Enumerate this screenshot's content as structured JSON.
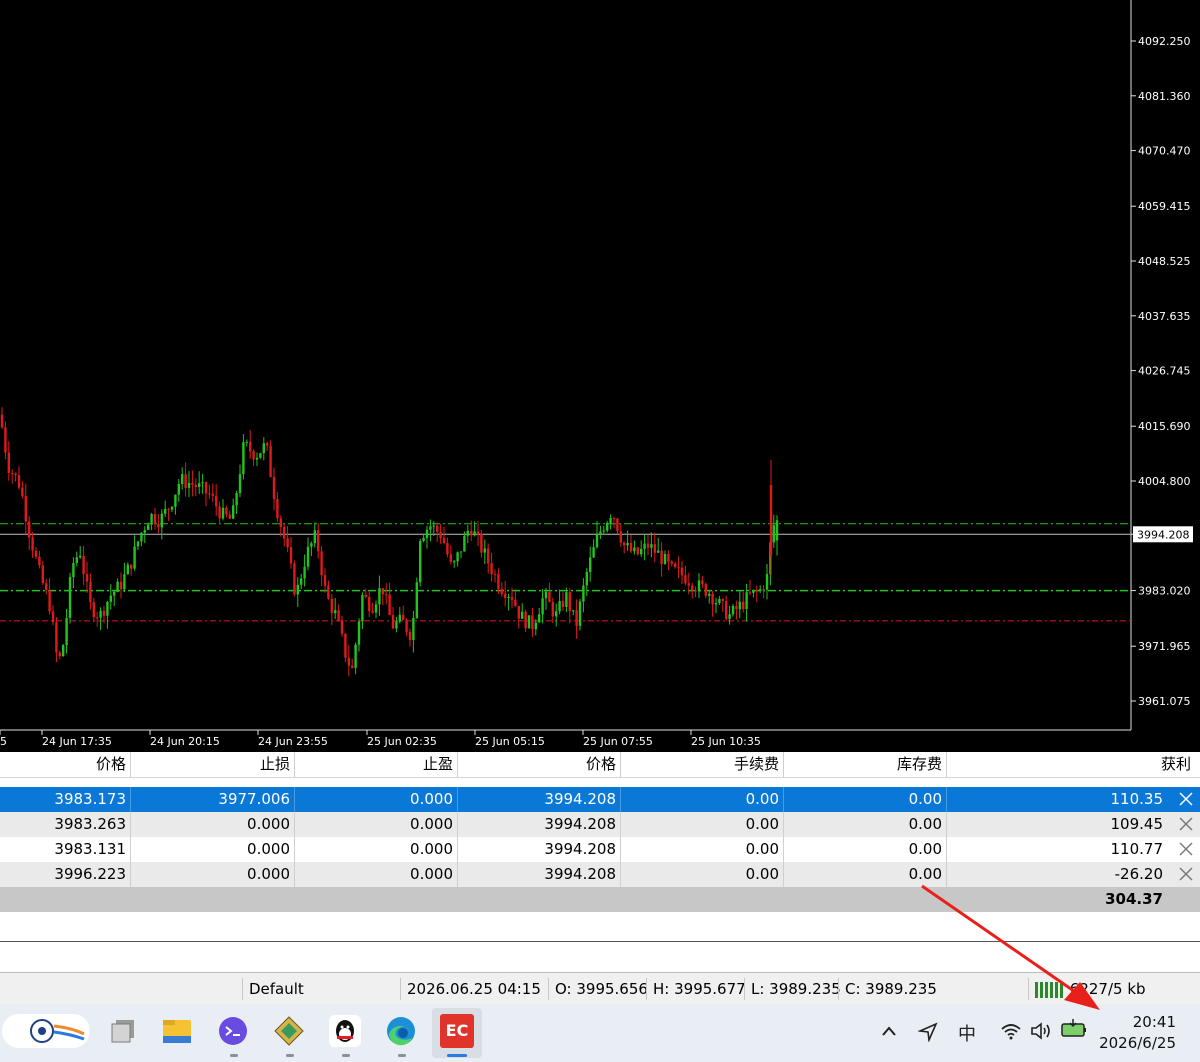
{
  "chart": {
    "price_axis": [
      "4092.250",
      "4081.360",
      "4070.470",
      "4059.415",
      "4048.525",
      "4037.635",
      "4026.745",
      "4015.690",
      "4004.800",
      "3994.208",
      "3983.020",
      "3971.965",
      "3961.075"
    ],
    "current_price_label": "3994.208",
    "time_axis": [
      "5",
      "24 Jun 17:35",
      "24 Jun 20:15",
      "24 Jun 23:55",
      "25 Jun 02:35",
      "25 Jun 05:15",
      "25 Jun 07:55",
      "25 Jun 10:35"
    ],
    "colors": {
      "bull": "#22c41e",
      "bear": "#e01a1a",
      "bid_line": "#bfbfbf",
      "entry_line": "#22c41e",
      "sl_line": "#e01a1a"
    },
    "levels": {
      "entry_upper": 3996.3,
      "entry_lower": 3983.0,
      "stop_loss": 3977.0,
      "current": 3994.208
    }
  },
  "table": {
    "headers": [
      "价格",
      "止损",
      "止盈",
      "价格",
      "手续费",
      "库存费",
      "获利"
    ],
    "rows": [
      {
        "cells": [
          "3983.173",
          "3977.006",
          "0.000",
          "3994.208",
          "0.00",
          "0.00",
          "110.35"
        ],
        "style": "sel"
      },
      {
        "cells": [
          "3983.263",
          "0.000",
          "0.000",
          "3994.208",
          "0.00",
          "0.00",
          "109.45"
        ],
        "style": "alt"
      },
      {
        "cells": [
          "3983.131",
          "0.000",
          "0.000",
          "3994.208",
          "0.00",
          "0.00",
          "110.77"
        ],
        "style": "plain"
      },
      {
        "cells": [
          "3996.223",
          "0.000",
          "0.000",
          "3994.208",
          "0.00",
          "0.00",
          "-26.20"
        ],
        "style": "alt"
      }
    ],
    "total": "304.37"
  },
  "status": {
    "profile": "Default",
    "datetime": "2026.06.25 04:15",
    "open": "O: 3995.656",
    "high": "H: 3995.677",
    "low": "L: 3989.235",
    "close": "C: 3989.235",
    "traffic": "6227/5 kb"
  },
  "taskbar": {
    "ime": "中",
    "time": "20:41",
    "date": "2026/6/25",
    "ec_label": "EC"
  }
}
